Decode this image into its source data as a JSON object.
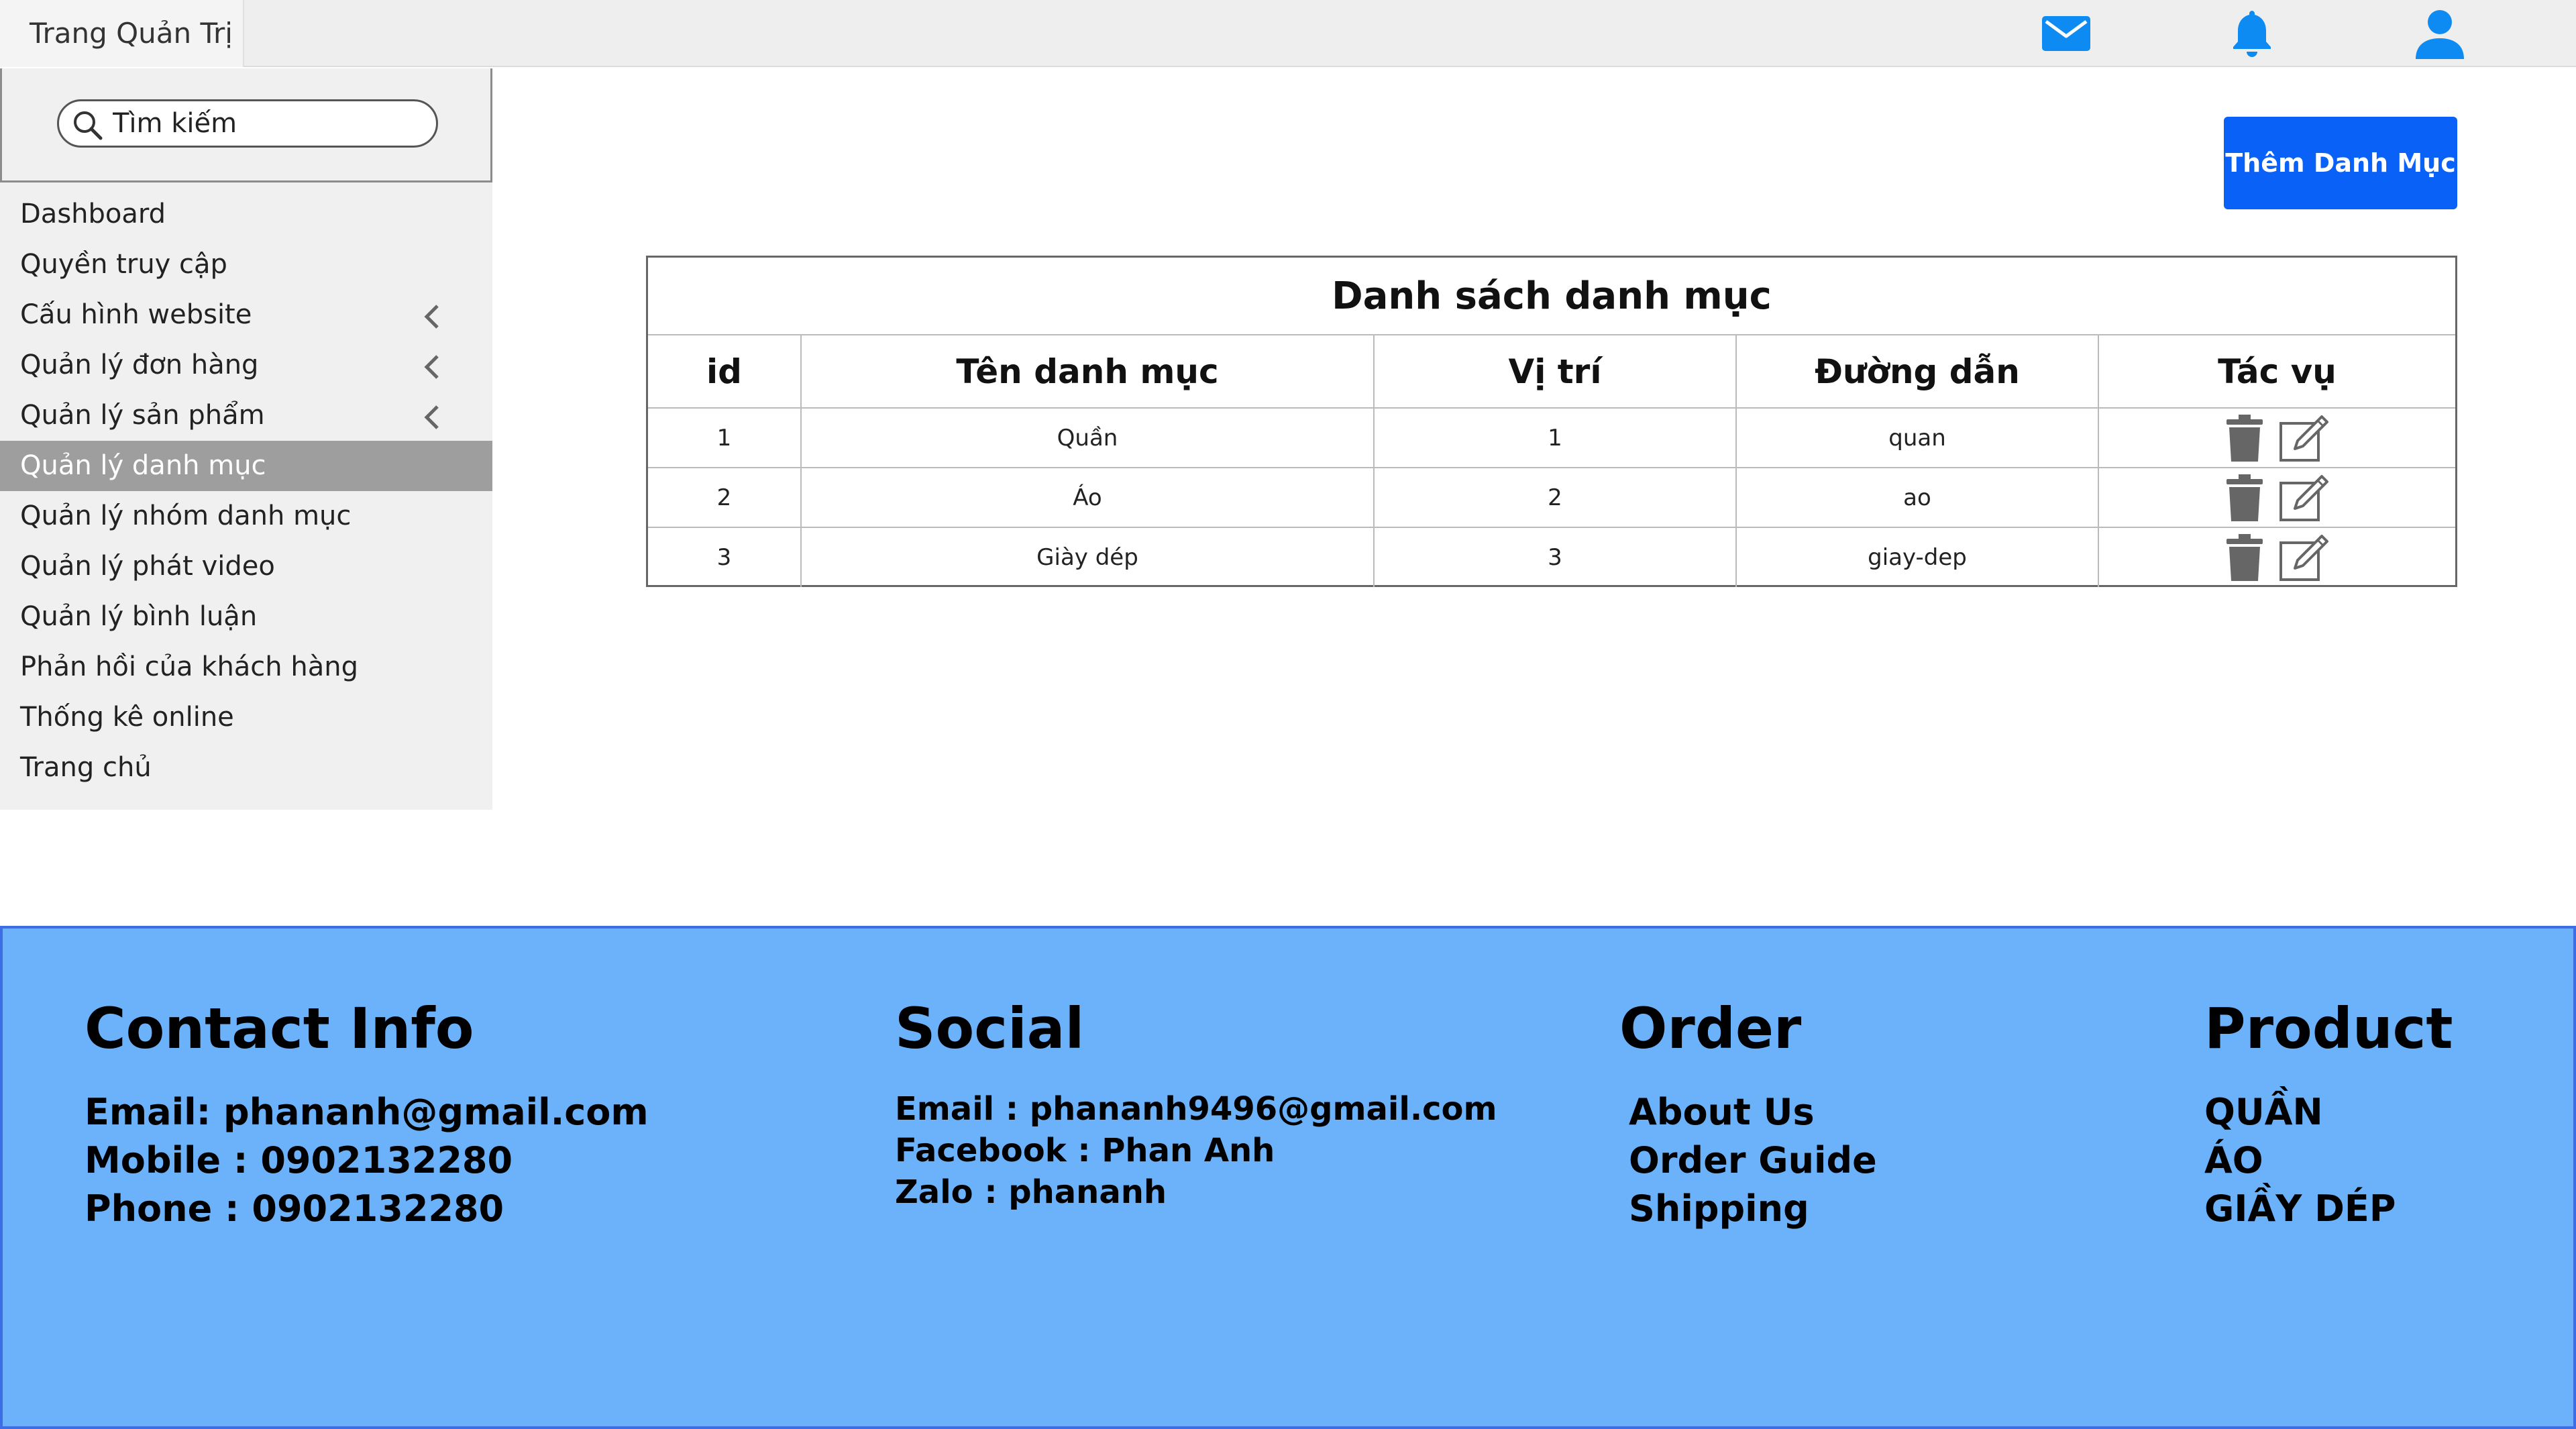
{
  "header": {
    "title": "Trang Quản Trị",
    "icons": [
      "mail-icon",
      "bell-icon",
      "user-icon"
    ],
    "icon_color": "#0d8bf2"
  },
  "sidebar": {
    "search_placeholder": "Tìm kiếm",
    "items": [
      {
        "label": "Dashboard"
      },
      {
        "label": "Quyền truy cập"
      },
      {
        "label": "Cấu hình website",
        "has_chevron": true
      },
      {
        "label": "Quản lý đơn hàng",
        "has_chevron": true
      },
      {
        "label": "Quản lý sản phẩm",
        "has_chevron": true
      },
      {
        "label": "Quản lý danh mục",
        "active": true
      },
      {
        "label": "Quản lý nhóm danh mục"
      },
      {
        "label": "Quản lý phát video"
      },
      {
        "label": "Quản lý bình luận"
      },
      {
        "label": "Phản hồi của khách hàng"
      },
      {
        "label": "Thống kê online"
      },
      {
        "label": "Trang chủ"
      }
    ]
  },
  "main": {
    "add_button_label": "Thêm Danh Mục",
    "add_button_color": "#0a61f8",
    "table": {
      "title": "Danh sách danh mục",
      "columns": [
        "id",
        "Tên danh mục",
        "Vị trí",
        "Đường dẫn",
        "Tác vụ"
      ],
      "rows": [
        [
          "1",
          "Quần",
          "1",
          "quan"
        ],
        [
          "2",
          "Áo",
          "2",
          "ao"
        ],
        [
          "3",
          "Giày dép",
          "3",
          "giay-dep"
        ]
      ],
      "row_actions": [
        "trash-icon",
        "edit-icon"
      ]
    }
  },
  "footer": {
    "background": "#6bb2fb",
    "contact": {
      "heading": "Contact Info",
      "lines": [
        "Email: phananh@gmail.com",
        "Mobile : 0902132280",
        "Phone : 0902132280"
      ]
    },
    "social": {
      "heading": "Social",
      "lines": [
        "Email : phananh9496@gmail.com",
        "Facebook : Phan Anh",
        "Zalo : phananh"
      ]
    },
    "order": {
      "heading": "Order",
      "lines": [
        "About Us",
        "Order Guide",
        "Shipping"
      ]
    },
    "product": {
      "heading": "Product",
      "lines": [
        "QUẦN",
        "ÁO",
        "GIẦY DÉP"
      ]
    }
  }
}
